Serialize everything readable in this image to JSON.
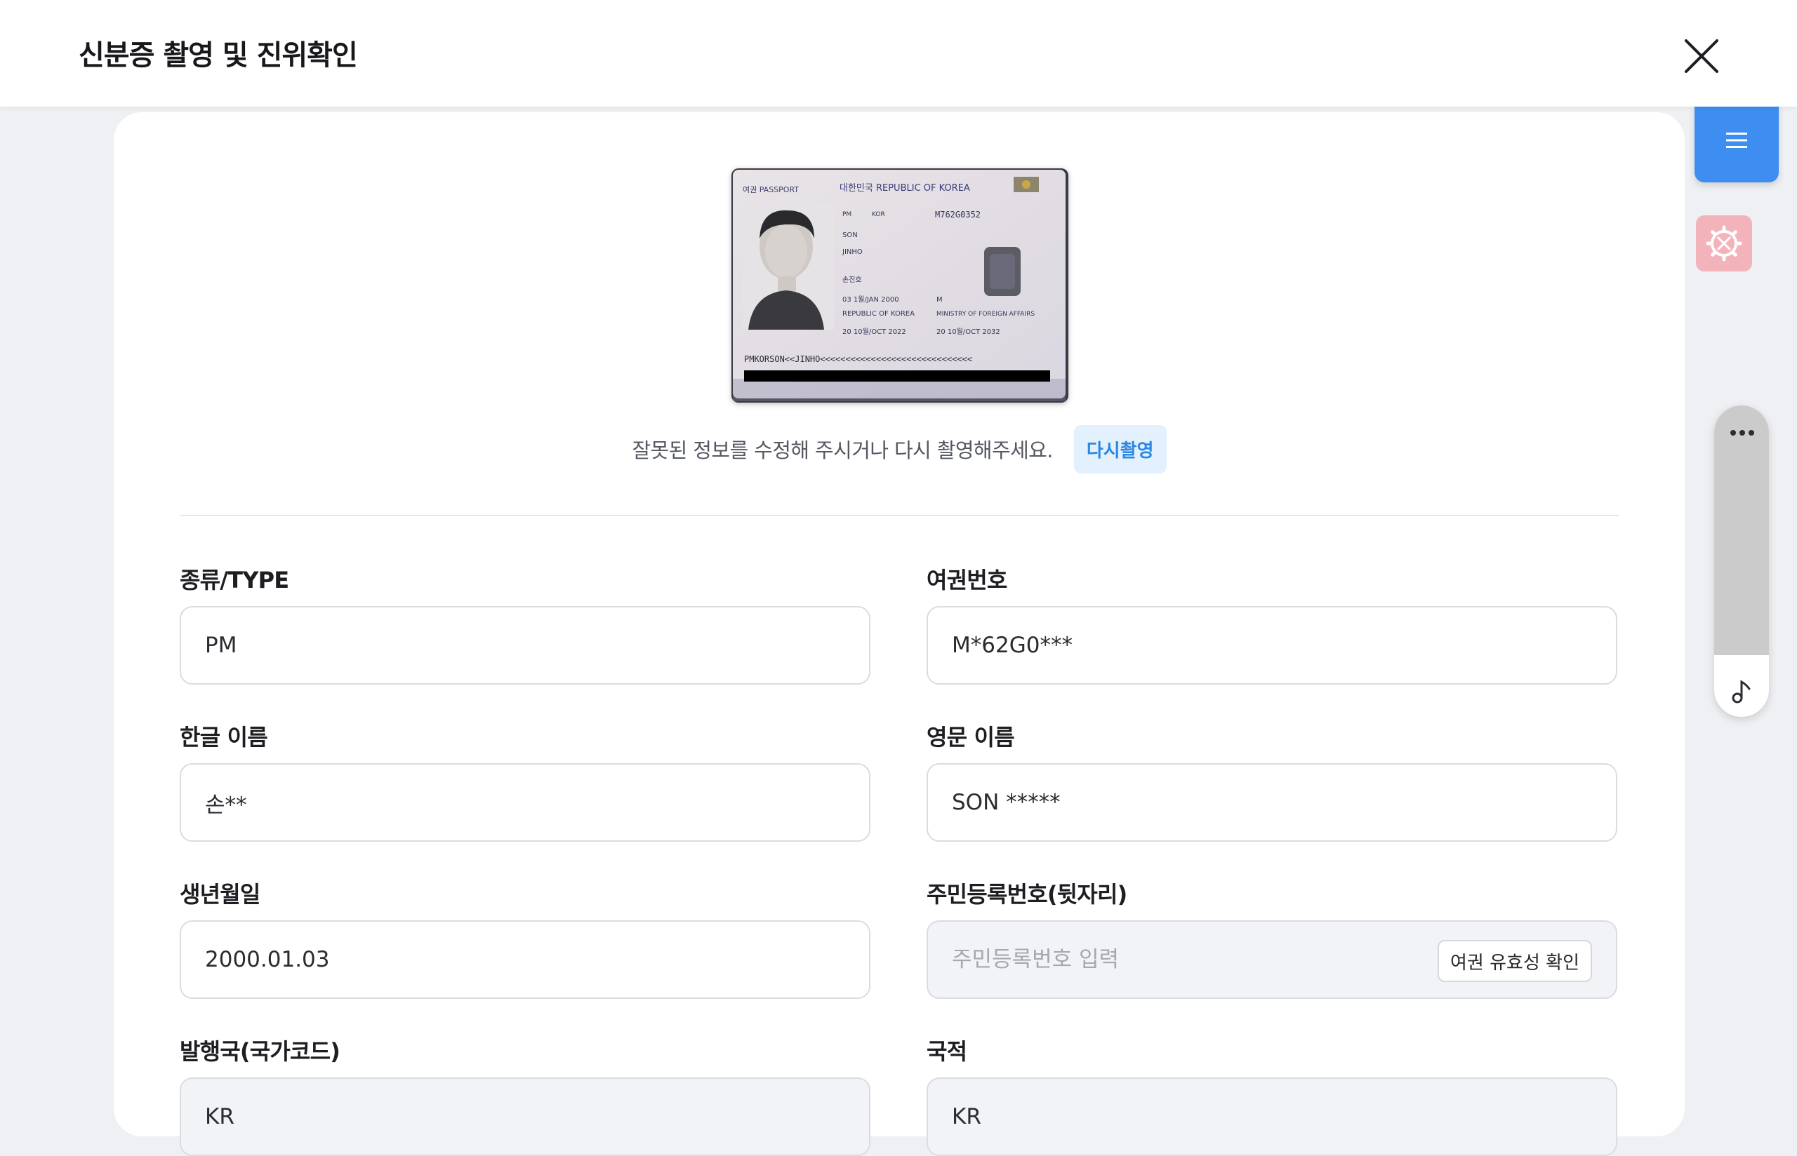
{
  "header": {
    "title": "신분증 촬영 및 진위확인"
  },
  "passport_image": {
    "label_left": "여권 PASSPORT",
    "label_center": "대한민국   REPUBLIC OF KOREA",
    "type": "PM",
    "country_code": "KOR",
    "passport_no": "M762G0352",
    "surname": "SON",
    "given_names": "JINHO",
    "korean_name": "손진호",
    "date_of_birth": "03 1월/JAN 2000",
    "sex": "M",
    "nationality": "REPUBLIC OF KOREA",
    "authority": "MINISTRY OF FOREIGN AFFAIRS",
    "date_of_issue": "20 10월/OCT 2022",
    "date_of_expiry": "20 10월/OCT 2032",
    "mrz_line": "PMKORSON<<JINHO<<<<<<<<<<<<<<<<<<<<<<<<<<<<<<"
  },
  "retake": {
    "message": "잘못된 정보를 수정해 주시거나 다시 촬영해주세요.",
    "button_label": "다시촬영"
  },
  "fields": {
    "type": {
      "label": "종류/TYPE",
      "value": "PM"
    },
    "passport_number": {
      "label": "여권번호",
      "value": "M*62G0***"
    },
    "korean_name": {
      "label": "한글 이름",
      "value": "손**"
    },
    "english_name": {
      "label": "영문 이름",
      "value": "SON *****"
    },
    "birth_date": {
      "label": "생년월일",
      "value": "2000.01.03"
    },
    "resident_number": {
      "label": "주민등록번호(뒷자리)",
      "placeholder": "주민등록번호 입력",
      "verify_button": "여권 유효성 확인"
    },
    "issuing_country": {
      "label": "발행국(국가코드)",
      "value": "KR"
    },
    "nationality": {
      "label": "국적",
      "value": "KR"
    }
  },
  "side_menu": {
    "menu_icon": "hamburger-icon",
    "tools_icon": "gear-wrench-icon",
    "widget_more_icon": "more-dots-icon",
    "widget_music_icon": "music-note-icon"
  },
  "colors": {
    "accent_blue": "#3d8ef0",
    "retake_bg": "#e3f0fd",
    "retake_text": "#2a87e3",
    "tools_pink": "#f3b3ba"
  }
}
